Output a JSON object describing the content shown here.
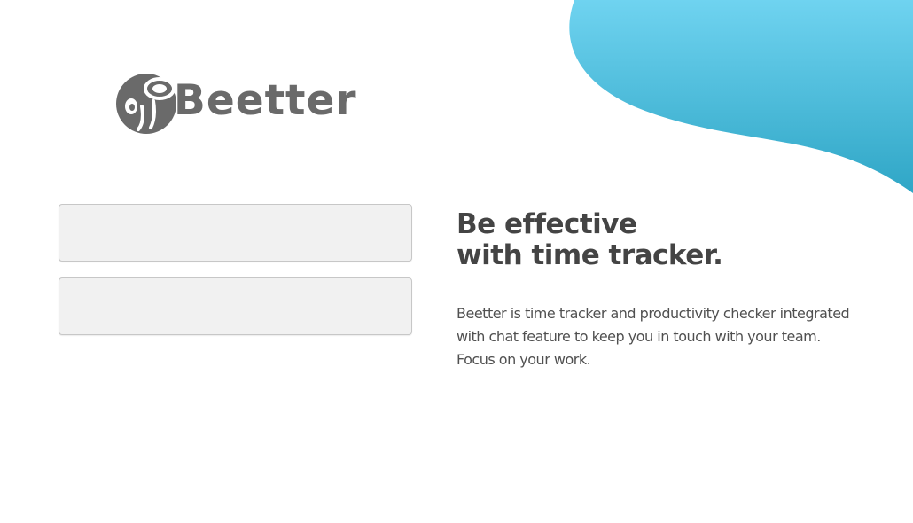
{
  "brand": {
    "name": "Beetter",
    "logo_icon": "bee-logo-icon",
    "logo_color": "#6a6a6a"
  },
  "login_form": {
    "field_1": {
      "value": "",
      "placeholder": ""
    },
    "field_2": {
      "value": "",
      "placeholder": ""
    }
  },
  "hero": {
    "headline_line1": "Be effective",
    "headline_line2": "with time tracker.",
    "description_line1": "Beetter is time tracker and productivity checker integrated",
    "description_line2": "with chat feature to keep you in touch with your team.",
    "description_line3": "Focus on your work."
  },
  "colors": {
    "blob_top": "#6fd3f0",
    "blob_bottom": "#2fa6c6",
    "text_dark": "#444444"
  }
}
